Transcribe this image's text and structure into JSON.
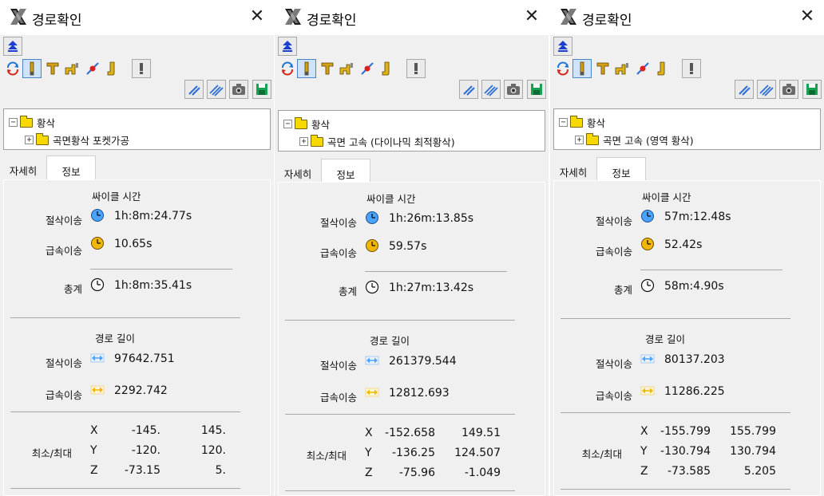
{
  "panels": [
    {
      "title": "경로확인",
      "tree": {
        "root": "황삭",
        "child": "곡면황삭 포켓가공"
      },
      "tabs": [
        "자세히",
        "정보"
      ],
      "cycle_time_label": "싸이클 시간",
      "cut_label": "절삭이송",
      "rapid_label": "급속이송",
      "total_label": "총계",
      "cut_time": "1h:8m:24.77s",
      "rapid_time": "10.65s",
      "total_time": "1h:8m:35.41s",
      "path_length_label": "경로 길이",
      "cut_length": "97642.751",
      "rapid_length": "2292.742",
      "minmax_label": "최소/최대",
      "axes": [
        "X",
        "Y",
        "Z"
      ],
      "min": [
        "-145.",
        "-120.",
        "-73.15"
      ],
      "max": [
        "145.",
        "120.",
        "5."
      ]
    },
    {
      "title": "경로확인",
      "tree": {
        "root": "황삭",
        "child": "곡면 고속 (다이나믹 최적황삭)"
      },
      "tabs": [
        "자세히",
        "정보"
      ],
      "cycle_time_label": "싸이클 시간",
      "cut_label": "절삭이송",
      "rapid_label": "급속이송",
      "total_label": "총계",
      "cut_time": "1h:26m:13.85s",
      "rapid_time": "59.57s",
      "total_time": "1h:27m:13.42s",
      "path_length_label": "경로 길이",
      "cut_length": "261379.544",
      "rapid_length": "12812.693",
      "minmax_label": "최소/최대",
      "axes": [
        "X",
        "Y",
        "Z"
      ],
      "min": [
        "-152.658",
        "-136.25",
        "-75.96"
      ],
      "max": [
        "149.51",
        "124.507",
        "-1.049"
      ]
    },
    {
      "title": "경로확인",
      "tree": {
        "root": "황삭",
        "child": "곡면 고속 (영역 황삭)"
      },
      "tabs": [
        "자세히",
        "정보"
      ],
      "cycle_time_label": "싸이클 시간",
      "cut_label": "절삭이송",
      "rapid_label": "급속이송",
      "total_label": "총계",
      "cut_time": "57m:12.48s",
      "rapid_time": "52.42s",
      "total_time": "58m:4.90s",
      "path_length_label": "경로 길이",
      "cut_length": "80137.203",
      "rapid_length": "11286.225",
      "minmax_label": "최소/최대",
      "axes": [
        "X",
        "Y",
        "Z"
      ],
      "min": [
        "-155.799",
        "-130.794",
        "-73.585"
      ],
      "max": [
        "155.799",
        "130.794",
        "5.205"
      ]
    }
  ],
  "icons": {
    "app": "mastercam-logo-icon",
    "close": "close-icon",
    "collapse": "collapse-up-icon",
    "toolbar_row1": [
      "refresh-cycle-icon",
      "tool-icon",
      "tool-holder-icon",
      "spindle-icon",
      "path-point-icon",
      "shank-icon",
      "alert-icon"
    ],
    "toolbar_row2": [
      "display-path-icon",
      "display-all-paths-icon",
      "camera-icon",
      "save-icon"
    ]
  },
  "colors": {
    "collapse_arrow": "#1a3fcf",
    "cut_icon": "#4aa3ff",
    "rapid_icon": "#f2b705",
    "folder": "#f7d900"
  }
}
